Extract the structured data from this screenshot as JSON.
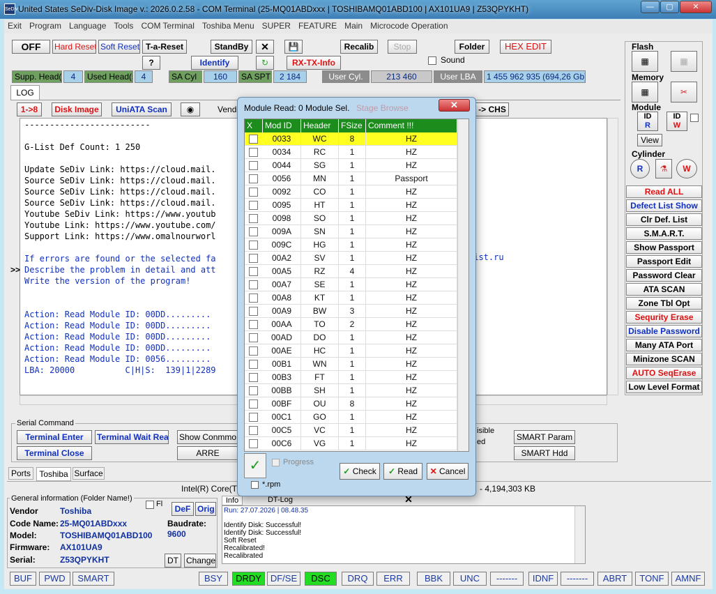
{
  "window": {
    "title": "United States  SeDiv-Disk Image v.: 2026.0.2.58 - COM Terminal  (25-MQ01ABDxxx | TOSHIBAMQ01ABD100 | AX101UA9 | Z53QPYKHT)",
    "logo": "SeDiv"
  },
  "menu": [
    "Exit",
    "Program",
    "Language",
    "Tools",
    "COM Terminal",
    "Toshiba Menu",
    "SUPER",
    "FEATURE",
    "Main",
    "Microcode Operation"
  ],
  "toolbar": {
    "off": "OFF",
    "hard_reset": "Hard Reset",
    "soft_reset": "Soft Reset",
    "t_a_reset": "T-a-Reset",
    "standby": "StandBy",
    "close": "✕",
    "save": "💾",
    "recalib": "Recalib",
    "stop": "Stop",
    "folder": "Folder",
    "hex_edit": "HEX EDIT",
    "help": "?",
    "identify": "Identify",
    "rx_tx_info": "RX-TX-Info",
    "sound": "Sound"
  },
  "info_row": {
    "supp_heads_label": "Supp. Head(s)",
    "supp_heads": "4",
    "used_heads_label": "Used Head(s)",
    "used_heads": "4",
    "sa_cyl_label": "SA Cyl",
    "sa_cyl": "160",
    "sa_spt_label": "SA SPT",
    "sa_spt": "2 184",
    "user_cyl_label": "User Cyl.",
    "user_cyl": "213 460",
    "user_lba_label": "User LBA",
    "user_lba": "1 455 962 935  (694,26 Gb)"
  },
  "tabs": {
    "log": "LOG"
  },
  "log_toolbar": {
    "b1": "1->8",
    "b2": "Disk Image",
    "b3": "UniATA Scan",
    "b4": "Vendo",
    "b5": "-> CHS",
    "expand": ">>"
  },
  "log_lines": [
    "-------------------------",
    "",
    "G-List Def Count: 1 250",
    "",
    "Update SeDiv Link: https://cloud.mail.",
    "Source SeDiv Link: https://cloud.mail.",
    "Source SeDiv Link: https://cloud.mail.",
    "Source SeDiv Link: https://cloud.mail.",
    "Youtube SeDiv Link: https://www.youtub",
    "Youtube Link: https://www.youtube.com/",
    "Support Link: https://www.omalnourworl",
    "",
    "If errors are found or the selected fa",
    "Describe the problem in detail and att",
    "Write the version of the program!",
    "",
    "",
    "Action: Read Module ID: 00DD.........",
    "Action: Read Module ID: 00DD.........",
    "Action: Read Module ID: 00DD.........",
    "Action: Read Module ID: 00DD.........",
    "Action: Read Module ID: 0056.........",
    "LBA: 20000          C|H|S:  139|1|2289"
  ],
  "log_extra": "list.ru",
  "right_panel": {
    "flash": "Flash",
    "memory": "Memory",
    "module": "Module",
    "view": "View",
    "cylinder": "Cylinder",
    "id_r": "ID",
    "id_w": "ID",
    "buttons": [
      "Read ALL",
      "Defect List Show",
      "Clr Def. List",
      "S.M.A.R.T.",
      "Show Passport",
      "Passport Edit",
      "Password Clear",
      "ATA SCAN",
      "Zone Tbl Opt",
      "Sequrity Erase",
      "Disable Password",
      "Many ATA Port",
      "Minizone SCAN",
      "AUTO SeqErase",
      "Low Level Format"
    ]
  },
  "serial": {
    "title": "Serial Command",
    "terminal_enter": "Terminal Enter",
    "terminal_wait": "Terminal Wait Ready",
    "show_command": "Show Conmmo",
    "terminal_close": "Terminal Close",
    "arre": "ARRE",
    "visible": "isible",
    "ed": "ed",
    "smart_param": "SMART Param",
    "smart_hdd": "SMART Hdd"
  },
  "bottom_tabs": [
    "Ports",
    "Toshiba",
    "Surface"
  ],
  "cpu_info": "Intel(R) Core(TM",
  "mem_info": "- 4,194,303 KB",
  "general": {
    "title": "General information (Folder Name!)",
    "fl": "Fl",
    "def": "DeF",
    "orig": "Orig",
    "vendor_label": "Vendor",
    "vendor": "Toshiba",
    "code_label": "Code Name:",
    "code": "25-MQ01ABDxxx",
    "model_label": "Model:",
    "model": "TOSHIBAMQ01ABD100",
    "firmware_label": "Firmware:",
    "firmware": "AX101UA9",
    "serial_label": "Serial:",
    "serial": "Z53QPYKHT",
    "baud_label": "Baudrate:",
    "baud": "9600",
    "dt": "DT",
    "change": "Change"
  },
  "info_tabs": {
    "info": "Info",
    "dt_log": "DT-Log"
  },
  "info_log": {
    "run": "Run: 27.07.2026 | 08.48.35",
    "lines": [
      "Identify Disk: Successful!",
      "Identify Disk: Successful!",
      "Soft Reset",
      "Recalibrated!",
      "Recalibrated"
    ]
  },
  "status_bar": [
    "BUF",
    "PWD",
    "SMART",
    "BSY",
    "DRDY",
    "DF/SE",
    "DSC",
    "DRQ",
    "ERR",
    "BBK",
    "UNC",
    "-------",
    "IDNF",
    "-------",
    "ABRT",
    "TONF",
    "AMNF"
  ],
  "status_on": [
    "DRDY",
    "DSC"
  ],
  "modal": {
    "title": "Module Read: 0 Module Sel.",
    "ghost": "Stage Browse",
    "headers": [
      "X",
      "Mod ID",
      "Header",
      "FSize",
      "Comment !!!"
    ],
    "rows": [
      [
        "0033",
        "WC",
        "8",
        "HZ"
      ],
      [
        "0034",
        "RC",
        "1",
        "HZ"
      ],
      [
        "0044",
        "SG",
        "1",
        "HZ"
      ],
      [
        "0056",
        "MN",
        "1",
        "Passport"
      ],
      [
        "0092",
        "CO",
        "1",
        "HZ"
      ],
      [
        "0095",
        "HT",
        "1",
        "HZ"
      ],
      [
        "0098",
        "SO",
        "1",
        "HZ"
      ],
      [
        "009A",
        "SN",
        "1",
        "HZ"
      ],
      [
        "009C",
        "HG",
        "1",
        "HZ"
      ],
      [
        "00A2",
        "SV",
        "1",
        "HZ"
      ],
      [
        "00A5",
        "RZ",
        "4",
        "HZ"
      ],
      [
        "00A7",
        "SE",
        "1",
        "HZ"
      ],
      [
        "00A8",
        "KT",
        "1",
        "HZ"
      ],
      [
        "00A9",
        "BW",
        "3",
        "HZ"
      ],
      [
        "00AA",
        "TO",
        "2",
        "HZ"
      ],
      [
        "00AD",
        "DO",
        "1",
        "HZ"
      ],
      [
        "00AE",
        "HC",
        "1",
        "HZ"
      ],
      [
        "00B1",
        "WN",
        "1",
        "HZ"
      ],
      [
        "00B3",
        "FT",
        "1",
        "HZ"
      ],
      [
        "00BB",
        "SH",
        "1",
        "HZ"
      ],
      [
        "00BF",
        "OU",
        "8",
        "HZ"
      ],
      [
        "00C1",
        "GO",
        "1",
        "HZ"
      ],
      [
        "00C5",
        "VC",
        "1",
        "HZ"
      ],
      [
        "00C6",
        "VG",
        "1",
        "HZ"
      ]
    ],
    "progress": "Progress",
    "rpm": "*.rpm",
    "check": "Check",
    "read": "Read",
    "cancel": "Cancel"
  }
}
